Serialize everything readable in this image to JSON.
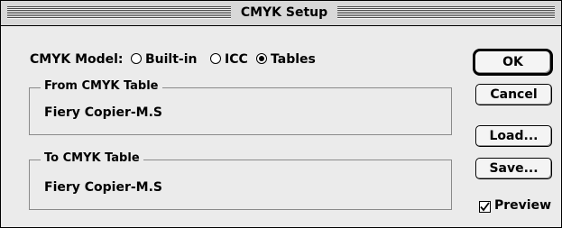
{
  "window": {
    "title": "CMYK Setup"
  },
  "cmyk_model": {
    "label": "CMYK Model:",
    "options": [
      {
        "label": "Built-in",
        "selected": false
      },
      {
        "label": "ICC",
        "selected": false
      },
      {
        "label": "Tables",
        "selected": true
      }
    ]
  },
  "from_table": {
    "label": "From CMYK Table",
    "value": "Fiery Copier-M.S"
  },
  "to_table": {
    "label": "To CMYK Table",
    "value": "Fiery Copier-M.S"
  },
  "buttons": {
    "ok": "OK",
    "cancel": "Cancel",
    "load": "Load...",
    "save": "Save..."
  },
  "preview": {
    "label": "Preview",
    "checked": true
  }
}
